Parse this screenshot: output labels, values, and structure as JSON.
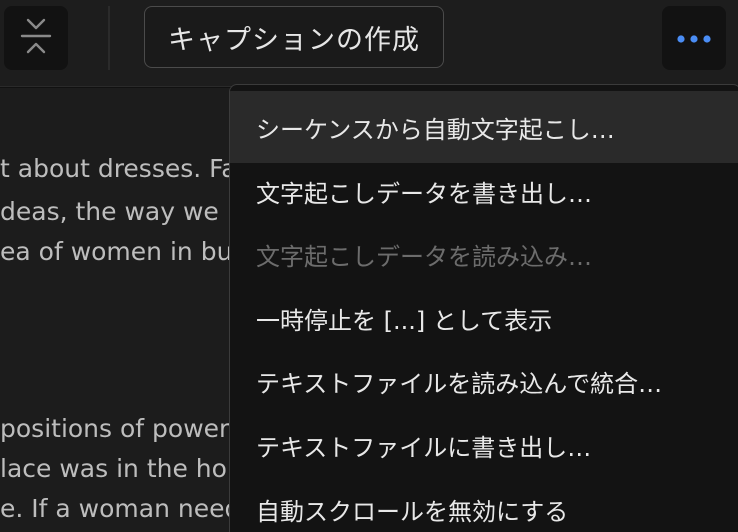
{
  "toolbar": {
    "collapse_icon": "collapse-vertical-icon",
    "caption_button_label": "キャプションの作成",
    "more_icon": "more-horizontal-icon",
    "more_icon_color": "#4a8df5"
  },
  "transcript": {
    "lines": [
      "t about dresses. Fashio",
      "deas, the way we live",
      "ea of women in busin",
      "positions of power an",
      "lace was in the home",
      "e. If a woman needed"
    ]
  },
  "menu": {
    "items": [
      {
        "label": "シーケンスから自動文字起こし…",
        "state": "hover"
      },
      {
        "label": "文字起こしデータを書き出し…",
        "state": "normal"
      },
      {
        "label": "文字起こしデータを読み込み…",
        "state": "disabled"
      },
      {
        "label": "一時停止を [...] として表示",
        "state": "normal"
      },
      {
        "label": "テキストファイルを読み込んで統合…",
        "state": "normal"
      },
      {
        "label": "テキストファイルに書き出し…",
        "state": "normal"
      },
      {
        "label": "自動スクロールを無効にする",
        "state": "normal"
      }
    ]
  }
}
